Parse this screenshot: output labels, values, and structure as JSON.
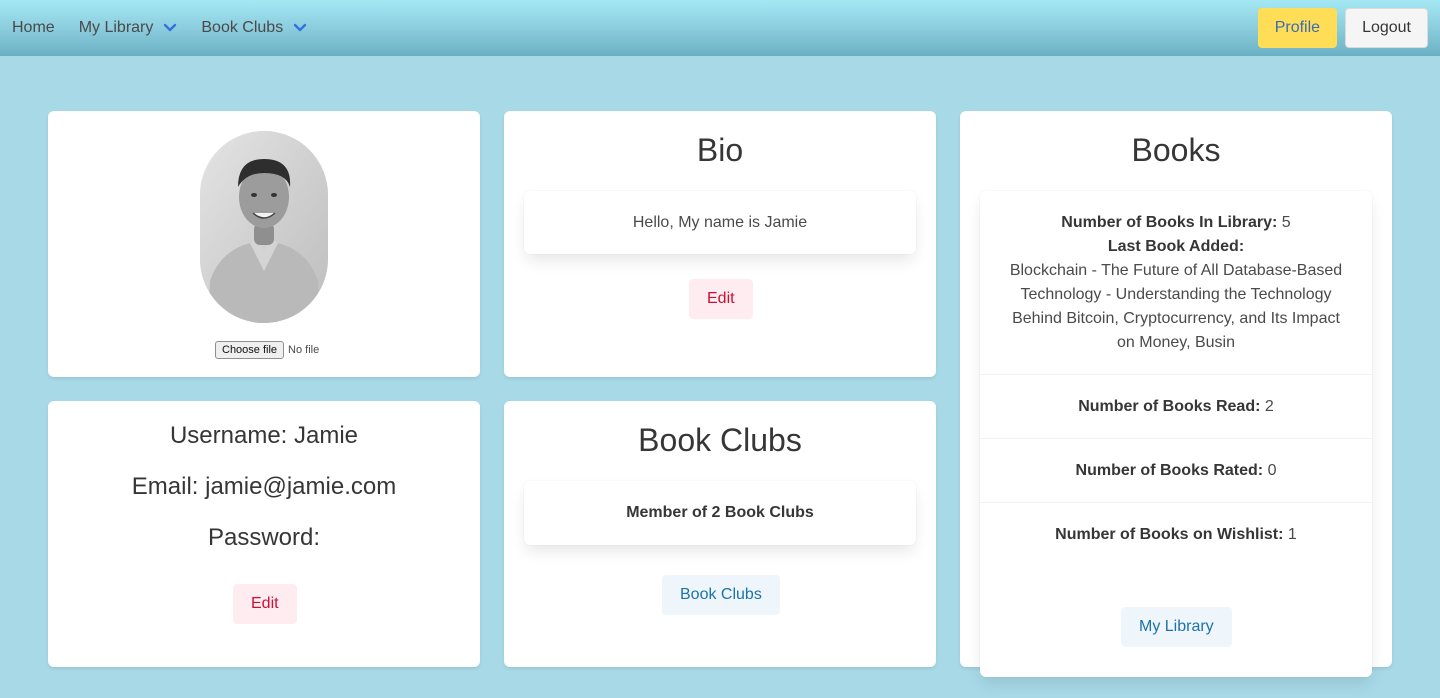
{
  "nav": {
    "home": "Home",
    "my_library": "My Library",
    "book_clubs": "Book Clubs",
    "profile": "Profile",
    "logout": "Logout"
  },
  "avatar_card": {
    "choose_file": "Choose file",
    "no_file": "No file"
  },
  "bio_card": {
    "title": "Bio",
    "bio_text": "Hello, My name is Jamie",
    "edit": "Edit"
  },
  "books_card": {
    "title": "Books",
    "library_label": "Number of Books In Library:",
    "library_value": "5",
    "last_added_label": "Last Book Added:",
    "last_added_value": "Blockchain - The Future of All Database-Based Technology - Understanding the Technology Behind Bitcoin, Cryptocurrency, and Its Impact on Money, Busin",
    "read_label": "Number of Books Read:",
    "read_value": "2",
    "rated_label": "Number of Books Rated:",
    "rated_value": "0",
    "wishlist_label": "Number of Books on Wishlist:",
    "wishlist_value": "1",
    "my_library_button": "My Library"
  },
  "account_card": {
    "username": "Username: Jamie",
    "email": "Email: jamie@jamie.com",
    "password": "Password:",
    "edit": "Edit"
  },
  "clubs_card": {
    "title": "Book Clubs",
    "member_text": "Member of 2 Book Clubs",
    "button": "Book Clubs"
  },
  "colors": {
    "background": "#a7d9e6",
    "profile_button": "#ffdd57",
    "danger_light": "#feecf0",
    "info_light": "#eef6fc"
  }
}
